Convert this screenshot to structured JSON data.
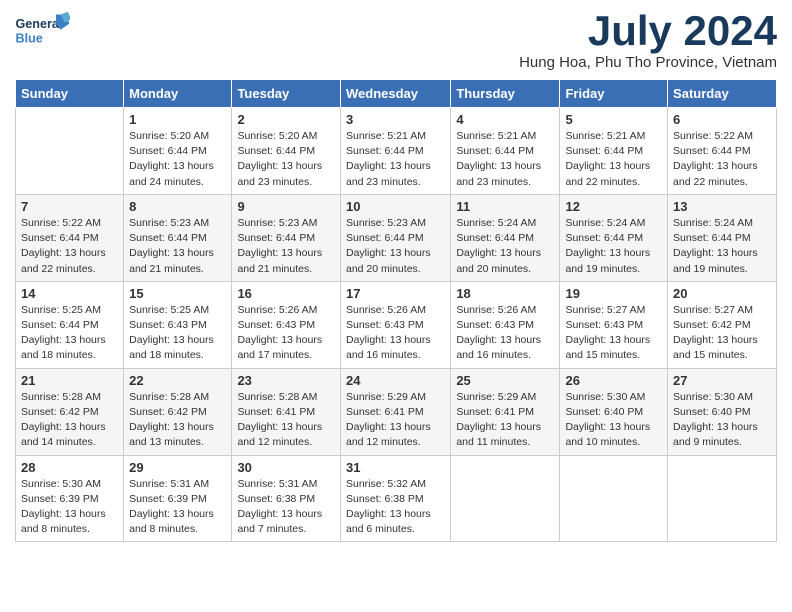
{
  "logo": {
    "general": "General",
    "blue": "Blue"
  },
  "title": {
    "month_year": "July 2024",
    "location": "Hung Hoa, Phu Tho Province, Vietnam"
  },
  "days_of_week": [
    "Sunday",
    "Monday",
    "Tuesday",
    "Wednesday",
    "Thursday",
    "Friday",
    "Saturday"
  ],
  "weeks": [
    [
      {
        "day": "",
        "info": ""
      },
      {
        "day": "1",
        "info": "Sunrise: 5:20 AM\nSunset: 6:44 PM\nDaylight: 13 hours\nand 24 minutes."
      },
      {
        "day": "2",
        "info": "Sunrise: 5:20 AM\nSunset: 6:44 PM\nDaylight: 13 hours\nand 23 minutes."
      },
      {
        "day": "3",
        "info": "Sunrise: 5:21 AM\nSunset: 6:44 PM\nDaylight: 13 hours\nand 23 minutes."
      },
      {
        "day": "4",
        "info": "Sunrise: 5:21 AM\nSunset: 6:44 PM\nDaylight: 13 hours\nand 23 minutes."
      },
      {
        "day": "5",
        "info": "Sunrise: 5:21 AM\nSunset: 6:44 PM\nDaylight: 13 hours\nand 22 minutes."
      },
      {
        "day": "6",
        "info": "Sunrise: 5:22 AM\nSunset: 6:44 PM\nDaylight: 13 hours\nand 22 minutes."
      }
    ],
    [
      {
        "day": "7",
        "info": "Sunrise: 5:22 AM\nSunset: 6:44 PM\nDaylight: 13 hours\nand 22 minutes."
      },
      {
        "day": "8",
        "info": "Sunrise: 5:23 AM\nSunset: 6:44 PM\nDaylight: 13 hours\nand 21 minutes."
      },
      {
        "day": "9",
        "info": "Sunrise: 5:23 AM\nSunset: 6:44 PM\nDaylight: 13 hours\nand 21 minutes."
      },
      {
        "day": "10",
        "info": "Sunrise: 5:23 AM\nSunset: 6:44 PM\nDaylight: 13 hours\nand 20 minutes."
      },
      {
        "day": "11",
        "info": "Sunrise: 5:24 AM\nSunset: 6:44 PM\nDaylight: 13 hours\nand 20 minutes."
      },
      {
        "day": "12",
        "info": "Sunrise: 5:24 AM\nSunset: 6:44 PM\nDaylight: 13 hours\nand 19 minutes."
      },
      {
        "day": "13",
        "info": "Sunrise: 5:24 AM\nSunset: 6:44 PM\nDaylight: 13 hours\nand 19 minutes."
      }
    ],
    [
      {
        "day": "14",
        "info": "Sunrise: 5:25 AM\nSunset: 6:44 PM\nDaylight: 13 hours\nand 18 minutes."
      },
      {
        "day": "15",
        "info": "Sunrise: 5:25 AM\nSunset: 6:43 PM\nDaylight: 13 hours\nand 18 minutes."
      },
      {
        "day": "16",
        "info": "Sunrise: 5:26 AM\nSunset: 6:43 PM\nDaylight: 13 hours\nand 17 minutes."
      },
      {
        "day": "17",
        "info": "Sunrise: 5:26 AM\nSunset: 6:43 PM\nDaylight: 13 hours\nand 16 minutes."
      },
      {
        "day": "18",
        "info": "Sunrise: 5:26 AM\nSunset: 6:43 PM\nDaylight: 13 hours\nand 16 minutes."
      },
      {
        "day": "19",
        "info": "Sunrise: 5:27 AM\nSunset: 6:43 PM\nDaylight: 13 hours\nand 15 minutes."
      },
      {
        "day": "20",
        "info": "Sunrise: 5:27 AM\nSunset: 6:42 PM\nDaylight: 13 hours\nand 15 minutes."
      }
    ],
    [
      {
        "day": "21",
        "info": "Sunrise: 5:28 AM\nSunset: 6:42 PM\nDaylight: 13 hours\nand 14 minutes."
      },
      {
        "day": "22",
        "info": "Sunrise: 5:28 AM\nSunset: 6:42 PM\nDaylight: 13 hours\nand 13 minutes."
      },
      {
        "day": "23",
        "info": "Sunrise: 5:28 AM\nSunset: 6:41 PM\nDaylight: 13 hours\nand 12 minutes."
      },
      {
        "day": "24",
        "info": "Sunrise: 5:29 AM\nSunset: 6:41 PM\nDaylight: 13 hours\nand 12 minutes."
      },
      {
        "day": "25",
        "info": "Sunrise: 5:29 AM\nSunset: 6:41 PM\nDaylight: 13 hours\nand 11 minutes."
      },
      {
        "day": "26",
        "info": "Sunrise: 5:30 AM\nSunset: 6:40 PM\nDaylight: 13 hours\nand 10 minutes."
      },
      {
        "day": "27",
        "info": "Sunrise: 5:30 AM\nSunset: 6:40 PM\nDaylight: 13 hours\nand 9 minutes."
      }
    ],
    [
      {
        "day": "28",
        "info": "Sunrise: 5:30 AM\nSunset: 6:39 PM\nDaylight: 13 hours\nand 8 minutes."
      },
      {
        "day": "29",
        "info": "Sunrise: 5:31 AM\nSunset: 6:39 PM\nDaylight: 13 hours\nand 8 minutes."
      },
      {
        "day": "30",
        "info": "Sunrise: 5:31 AM\nSunset: 6:38 PM\nDaylight: 13 hours\nand 7 minutes."
      },
      {
        "day": "31",
        "info": "Sunrise: 5:32 AM\nSunset: 6:38 PM\nDaylight: 13 hours\nand 6 minutes."
      },
      {
        "day": "",
        "info": ""
      },
      {
        "day": "",
        "info": ""
      },
      {
        "day": "",
        "info": ""
      }
    ]
  ]
}
